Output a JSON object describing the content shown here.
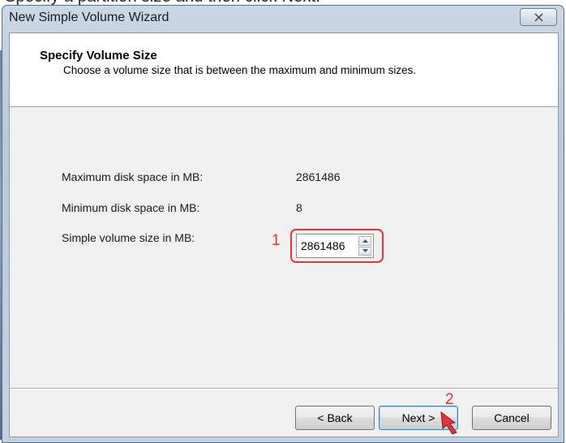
{
  "top_caption": "Specify a partition size and then click Next.",
  "window": {
    "title": "New Simple Volume Wizard",
    "close_symbol": "✕"
  },
  "header": {
    "title": "Specify Volume Size",
    "subtitle": "Choose a volume size that is between the maximum and minimum sizes."
  },
  "fields": {
    "max_label": "Maximum disk space in MB:",
    "max_value": "2861486",
    "min_label": "Minimum disk space in MB:",
    "min_value": "8",
    "size_label": "Simple volume size in MB:",
    "size_value": "2861486"
  },
  "annotations": {
    "step1": "1",
    "step2": "2",
    "accent_color": "#e0353a"
  },
  "footer": {
    "back_label": "< Back",
    "next_label": "Next >",
    "cancel_label": "Cancel"
  }
}
